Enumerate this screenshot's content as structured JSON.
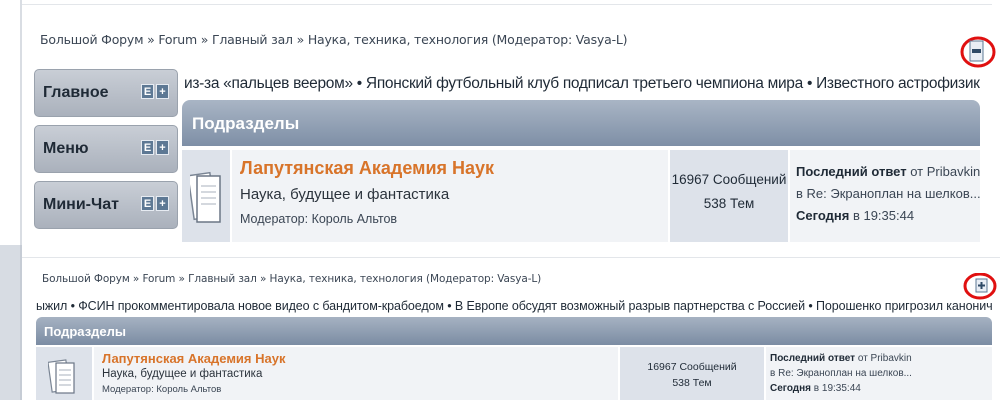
{
  "top": {
    "breadcrumb": "Большой Форум » Forum » Главный зал  » Наука, техника, технология  (Модератор: Vasya-L)",
    "sidebar": [
      {
        "label": "Главное",
        "edit": "E",
        "expand": "+"
      },
      {
        "label": "Меню",
        "edit": "E",
        "expand": "+"
      },
      {
        "label": "Мини-Чат",
        "edit": "E",
        "expand": "+"
      }
    ],
    "ticker": "из-за «пальцев веером» • Японский футбольный клуб подписал третьего чемпиона мира • Известного астрофизика-телеведущего обвинили",
    "section_header": "Подразделы",
    "board": {
      "title": "Лапутянская Академия Наук",
      "subtitle": "Наука, будущее и фантастика",
      "moderator_prefix": "Модератор:",
      "moderator": "Король Альтов",
      "messages": "16967 Сообщений",
      "topics": "538 Тем",
      "last_label": "Последний ответ",
      "last_from": "от Pribavkin",
      "last_in": "в",
      "last_topic": "Re: Экраноплан на шелков...",
      "last_day": "Сегодня",
      "last_time": "в 19:35:44"
    }
  },
  "bottom": {
    "breadcrumb": "Большой Форум » Forum » Главный зал  » Наука, техника, технология  (Модератор: Vasya-L)",
    "ticker": "ыжил • ФСИН прокомментировала новое видео с бандитом-крабоедом • В Европе обсудят возможный разрыв партнерства с Россией • Порошенко пригрозил канонической церк",
    "section_header": "Подразделы",
    "board": {
      "title": "Лапутянская Академия Наук",
      "subtitle": "Наука, будущее и фантастика",
      "moderator_prefix": "Модератор:",
      "moderator": "Король Альтов",
      "messages": "16967 Сообщений",
      "topics": "538 Тем",
      "last_label": "Последний ответ",
      "last_from": "от Pribavkin",
      "last_in": "в",
      "last_topic": "Re: Экраноплан на шелков...",
      "last_day": "Сегодня",
      "last_time": "в 19:35:44"
    }
  },
  "colors": {
    "accent_orange": "#d8742a",
    "header_blue": "#7e8fa6",
    "highlight_red": "#e01010"
  },
  "icons": {
    "collapse": "collapse-sidebar-icon",
    "expand": "expand-sidebar-icon",
    "board": "board-document-icon"
  }
}
